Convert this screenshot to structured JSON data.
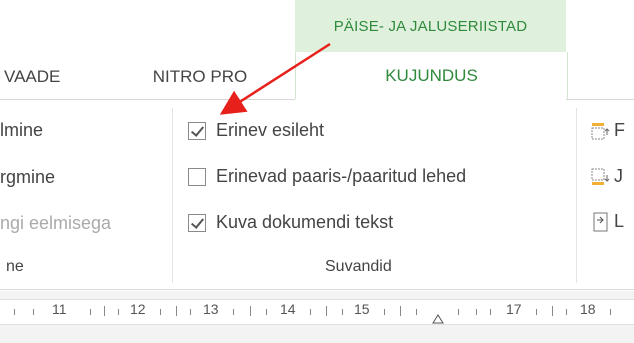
{
  "tabs": {
    "contextual_header": "PÄISE- JA JALUSERIISTAD",
    "vaade": "VAADE",
    "nitro": "NITRO PRO",
    "kujundus": "KUJUNDUS"
  },
  "navigation": {
    "items": [
      "lmine",
      "rgmine",
      "ngi eelmisega"
    ],
    "group_label": "ne"
  },
  "options": {
    "items": [
      {
        "label": "Erinev esileht",
        "checked": true
      },
      {
        "label": "Erinevad paaris-/paaritud lehed",
        "checked": false
      },
      {
        "label": "Kuva dokumendi tekst",
        "checked": true
      }
    ],
    "group_label": "Suvandid"
  },
  "position": {
    "items": [
      {
        "icon": "header-position-icon",
        "label": "F"
      },
      {
        "icon": "footer-position-icon",
        "label": "J"
      },
      {
        "icon": "insert-alignment-tab-icon",
        "label": "L"
      }
    ]
  },
  "ruler": {
    "numbers": [
      "11",
      "12",
      "13",
      "14",
      "15",
      "17",
      "18"
    ]
  },
  "colors": {
    "accent_green": "#2f8a3c",
    "contextual_bg": "#dff1dc",
    "annotation_arrow": "#e8201c"
  }
}
